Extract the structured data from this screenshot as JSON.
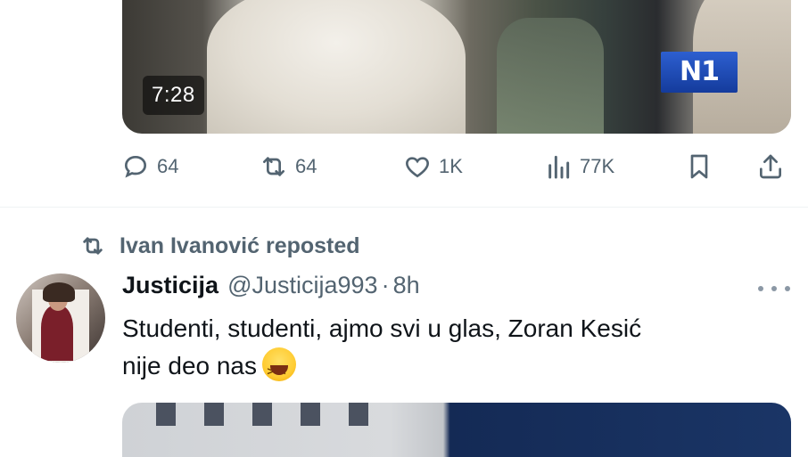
{
  "first_tweet": {
    "media": {
      "duration": "7:28",
      "watermark": "N1"
    },
    "actions": {
      "replies": "64",
      "reposts": "64",
      "likes": "1K",
      "views": "77K"
    }
  },
  "repost_header": {
    "text": "Ivan Ivanović reposted"
  },
  "second_tweet": {
    "display_name": "Justicija",
    "handle": "@Justicija993",
    "separator": "·",
    "time": "8h",
    "text_line1": "Studenti, studenti, ajmo svi u glas, Zoran Kesić",
    "text_line2": "nije deo nas",
    "emoji": "grinning-squinting-face"
  },
  "colors": {
    "text_primary": "#0f1419",
    "text_secondary": "#536471",
    "divider": "#eff3f4",
    "n1_brand": "#1f4fb8"
  },
  "icons": {
    "reply": "reply-icon",
    "repost": "repost-icon",
    "like": "like-icon",
    "views": "views-icon",
    "bookmark": "bookmark-icon",
    "share": "share-icon",
    "more": "more-icon"
  }
}
